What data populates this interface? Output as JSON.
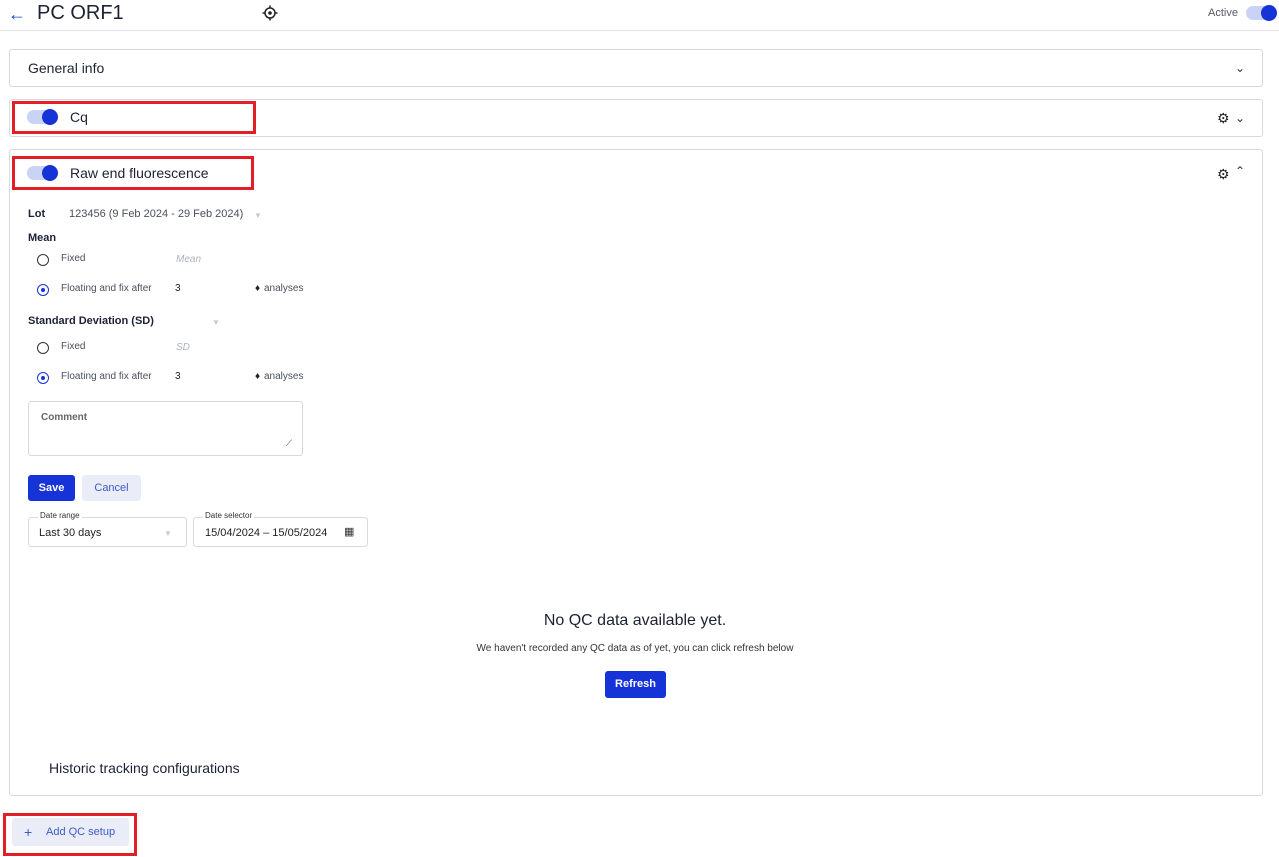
{
  "header": {
    "back_icon": "arrow-left-icon",
    "title": "PC ORF1",
    "target_icon": "crosshair-icon",
    "active_label": "Active",
    "active_on": true
  },
  "general_info": {
    "title": "General info"
  },
  "cq": {
    "title": "Cq",
    "enabled": true
  },
  "raw": {
    "title": "Raw end fluorescence",
    "enabled": true,
    "lot_label": "Lot",
    "lot_value": "123456 (9 Feb 2024 - 29 Feb 2024)",
    "mean_label": "Mean",
    "mean_fixed_label": "Fixed",
    "mean_placeholder": "Mean",
    "mean_floating_label": "Floating and fix after",
    "mean_floating_value": "3",
    "mean_analyses": "analyses",
    "sd_label": "Standard Deviation (SD)",
    "sd_fixed_label": "Fixed",
    "sd_placeholder": "SD",
    "sd_floating_label": "Floating and fix after",
    "sd_floating_value": "3",
    "sd_analyses": "analyses",
    "comment_label": "Comment",
    "save_label": "Save",
    "cancel_label": "Cancel",
    "date_range_label": "Date range",
    "date_range_value": "Last 30 days",
    "date_selector_label": "Date selector",
    "date_selector_value": "15/04/2024 – 15/05/2024",
    "empty_title": "No QC data available yet.",
    "empty_text": "We haven't recorded any QC data as of yet, you can click refresh below",
    "refresh_label": "Refresh",
    "historic_label": "Historic tracking configurations"
  },
  "footer": {
    "add_label": "Add QC setup"
  },
  "colors": {
    "accent": "#1533d6",
    "highlight": "#e01f26"
  }
}
